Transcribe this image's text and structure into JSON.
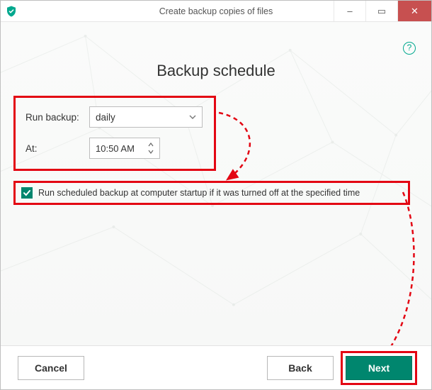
{
  "window": {
    "title": "Create backup copies of files"
  },
  "titlebar": {
    "minimize": "–",
    "maximize": "▭",
    "close": "✕"
  },
  "help": {
    "glyph": "?"
  },
  "heading": "Backup schedule",
  "schedule": {
    "run_label": "Run backup:",
    "frequency": "daily",
    "at_label": "At:",
    "time": "10:50  AM"
  },
  "startup": {
    "checked": true,
    "label": "Run scheduled backup at computer startup if it was turned off at the specified time"
  },
  "footer": {
    "cancel": "Cancel",
    "back": "Back",
    "next": "Next"
  },
  "colors": {
    "accent": "#00866e",
    "highlight": "#e30613"
  }
}
